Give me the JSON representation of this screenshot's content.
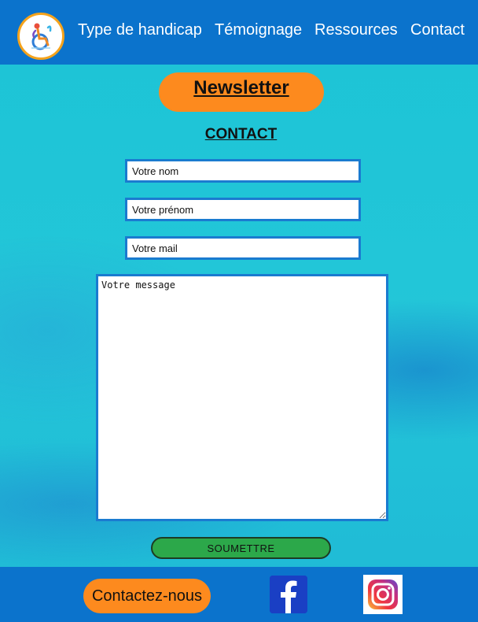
{
  "nav": {
    "items": [
      "Type de handicap",
      "Témoignage",
      "Ressources",
      "Contact"
    ]
  },
  "newsletter": {
    "label": "Newsletter"
  },
  "contact": {
    "title": "CONTACT",
    "name_placeholder": "Votre nom",
    "firstname_placeholder": "Votre prénom",
    "email_placeholder": "Votre mail",
    "message_placeholder": "Votre message",
    "submit_label": "SOUMETTRE"
  },
  "footer": {
    "contact_label": "Contactez-nous",
    "icons": [
      "facebook-icon",
      "instagram-icon"
    ]
  },
  "colors": {
    "header": "#0b73cc",
    "accent": "#fd8a1e",
    "submit": "#2ca84a",
    "field_border": "#1a7bd0"
  }
}
